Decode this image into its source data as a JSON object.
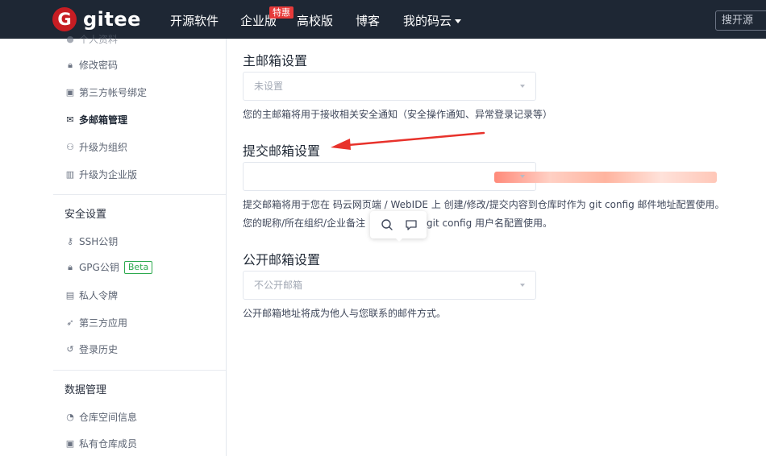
{
  "nav": {
    "logo": "gitee",
    "items": [
      "开源软件",
      "企业版",
      "高校版",
      "博客",
      "我的码云"
    ],
    "badge": "特惠",
    "search_placeholder": "搜开源"
  },
  "sidebar": {
    "items_top": [
      {
        "label": "个人资料",
        "icon": "user-icon"
      },
      {
        "label": "修改密码",
        "icon": "lock-icon"
      },
      {
        "label": "第三方帐号绑定",
        "icon": "link-icon"
      },
      {
        "label": "多邮箱管理",
        "icon": "mail-icon",
        "active": true
      },
      {
        "label": "升级为组织",
        "icon": "group-icon"
      },
      {
        "label": "升级为企业版",
        "icon": "building-icon"
      }
    ],
    "security_title": "安全设置",
    "security_items": [
      {
        "label": "SSH公钥",
        "icon": "key-icon"
      },
      {
        "label": "GPG公钥",
        "icon": "lock-icon",
        "badge": "Beta"
      },
      {
        "label": "私人令牌",
        "icon": "token-icon"
      },
      {
        "label": "第三方应用",
        "icon": "rocket-icon"
      },
      {
        "label": "登录历史",
        "icon": "history-icon"
      }
    ],
    "data_title": "数据管理",
    "data_items": [
      {
        "label": "仓库空间信息",
        "icon": "pie-icon"
      },
      {
        "label": "私有仓库成员",
        "icon": "member-icon"
      }
    ]
  },
  "main": {
    "primary": {
      "title": "主邮箱设置",
      "value": "未设置",
      "help": "您的主邮箱将用于接收相关安全通知（安全操作通知、异常登录记录等）"
    },
    "commit": {
      "title": "提交邮箱设置",
      "help_line1": "提交邮箱将用于您在 码云网页端 / WebIDE 上 创建/修改/提交内容到仓库时作为 git config 邮件地址配置使用。",
      "help_line2a": "您的昵称/所在组织/企业备注",
      "help_line2b": "git config 用户名配置使用。"
    },
    "public": {
      "title": "公开邮箱设置",
      "value": "不公开邮箱",
      "help": "公开邮箱地址将成为他人与您联系的邮件方式。"
    }
  },
  "colors": {
    "nav_bg": "#1e2734",
    "brand_red": "#c71d23",
    "beta_green": "#2eaa4f",
    "arrow_red": "#e8322b"
  }
}
